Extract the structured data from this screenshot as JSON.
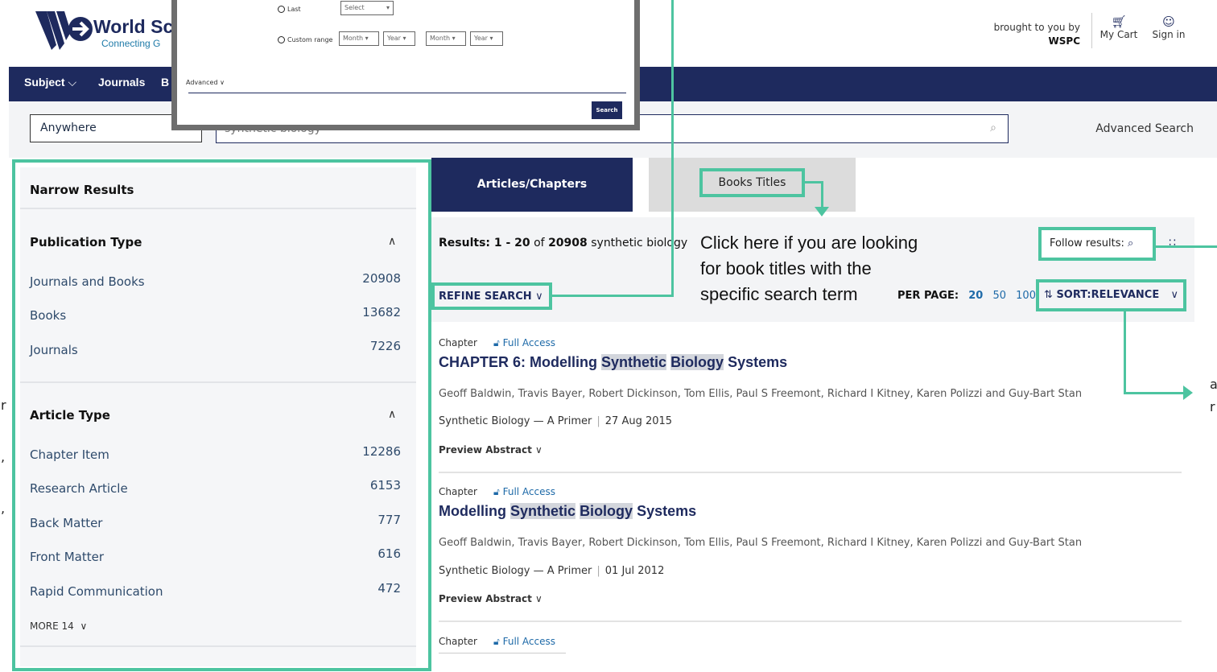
{
  "header": {
    "logo_text": "World Sc",
    "logo_tagline": "Connecting G",
    "brought_by": "brought to you by",
    "brought_org": "WSPC",
    "cart_label": "My Cart",
    "signin_label": "Sign in"
  },
  "nav": {
    "items": [
      "Subject",
      "Journals",
      "B"
    ]
  },
  "search": {
    "scope": "Anywhere",
    "query": "synthetic biology",
    "advanced_label": "Advanced Search"
  },
  "overlay": {
    "last_label": "Last",
    "last_select": "Select",
    "custom_label": "Custom range",
    "month1": "Month",
    "year1": "Year",
    "month2": "Month",
    "year2": "Year",
    "advanced_label": "Advanced",
    "search_button": "Search"
  },
  "filters": {
    "title": "Narrow Results",
    "publication_type": {
      "title": "Publication Type",
      "items": [
        {
          "label": "Journals and Books",
          "count": "20908"
        },
        {
          "label": "Books",
          "count": "13682"
        },
        {
          "label": "Journals",
          "count": "7226"
        }
      ]
    },
    "article_type": {
      "title": "Article Type",
      "items": [
        {
          "label": "Chapter Item",
          "count": "12286"
        },
        {
          "label": "Research Article",
          "count": "6153"
        },
        {
          "label": "Back Matter",
          "count": "777"
        },
        {
          "label": "Front Matter",
          "count": "616"
        },
        {
          "label": "Rapid Communication",
          "count": "472"
        }
      ],
      "more_label": "MORE 14"
    }
  },
  "tabs": {
    "articles": "Articles/Chapters",
    "books": "Books Titles"
  },
  "results_header": {
    "range_label": "Results: 1 - 20",
    "of_word": "of",
    "total": "20908",
    "term": "synthetic biology",
    "refine_label": "REFINE SEARCH",
    "callout_line1": "Click here if you are looking",
    "callout_line2": "for book titles with the",
    "callout_line3": "specific search term",
    "per_page_label": "PER PAGE:",
    "per_page_options": [
      "20",
      "50",
      "100"
    ],
    "follow_label": "Follow results:",
    "sort_label": "SORT:RELEVANCE"
  },
  "results": [
    {
      "type": "Chapter",
      "access": "Full Access",
      "title_pre": "CHAPTER 6: Modelling",
      "title_hl1": "Synthetic",
      "title_hl2": "Biology",
      "title_post": "Systems",
      "authors": "Geoff Baldwin, Travis Bayer, Robert Dickinson, Tom Ellis, Paul S Freemont, Richard I Kitney, Karen Polizzi and Guy-Bart Stan",
      "source": "Synthetic Biology — A Primer",
      "date": "27 Aug 2015",
      "preview": "Preview Abstract"
    },
    {
      "type": "Chapter",
      "access": "Full Access",
      "title_pre": "Modelling",
      "title_hl1": "Synthetic",
      "title_hl2": "Biology",
      "title_post": "Systems",
      "authors": "Geoff Baldwin, Travis Bayer, Robert Dickinson, Tom Ellis, Paul S Freemont, Richard I Kitney, Karen Polizzi and Guy-Bart Stan",
      "source": "Synthetic Biology — A Primer",
      "date": "01 Jul 2012",
      "preview": "Preview Abstract"
    },
    {
      "type": "Chapter",
      "access": "Full Access"
    }
  ],
  "edge_fragments": {
    "left1": "r",
    "left2": ",",
    "left3": ",",
    "right1": "a",
    "right2": "r"
  },
  "colors": {
    "navy": "#1e2a5e",
    "annotation_green": "#4dc4a0",
    "link_blue": "#1e6aa8"
  }
}
